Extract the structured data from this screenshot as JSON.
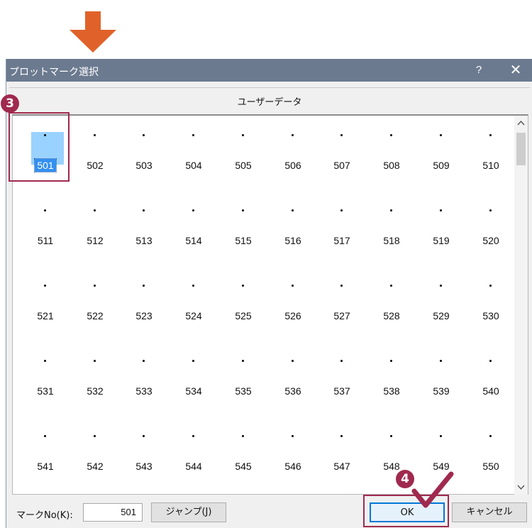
{
  "dialog": {
    "title": "プロットマーク選択",
    "help_label": "?",
    "close_label": "✕",
    "tab_label": "ユーザーデータ",
    "selected_mark": "501",
    "marks": [
      "501",
      "502",
      "503",
      "504",
      "505",
      "506",
      "507",
      "508",
      "509",
      "510",
      "511",
      "512",
      "513",
      "514",
      "515",
      "516",
      "517",
      "518",
      "519",
      "520",
      "521",
      "522",
      "523",
      "524",
      "525",
      "526",
      "527",
      "528",
      "529",
      "530",
      "531",
      "532",
      "533",
      "534",
      "535",
      "536",
      "537",
      "538",
      "539",
      "540",
      "541",
      "542",
      "543",
      "544",
      "545",
      "546",
      "547",
      "548",
      "549",
      "550"
    ]
  },
  "scroll": {
    "up_label": "^",
    "down_label": "v"
  },
  "bottom": {
    "mark_label": "マークNo(K):",
    "mark_value": "501",
    "jump_label": "ジャンプ(J)",
    "ok_label": "OK",
    "cancel_label": "キャンセル"
  },
  "annotations": {
    "step3": "3",
    "step4": "4"
  },
  "colors": {
    "arrow": "#e0622a",
    "annotation": "#a0294e",
    "titlebar": "#6b7a8f",
    "selection": "#99d1ff"
  }
}
